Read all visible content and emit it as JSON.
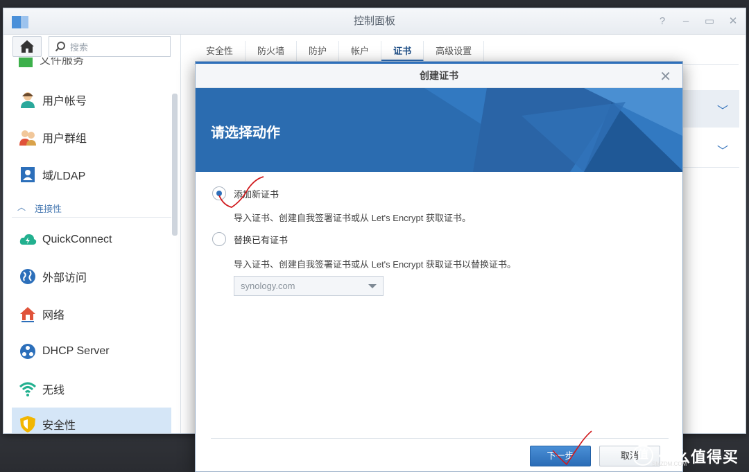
{
  "window": {
    "title": "控制面板",
    "controls": [
      "?",
      "–",
      "▭",
      "✕"
    ]
  },
  "sidebar": {
    "search_placeholder": "搜索",
    "partial_item": "文件服务",
    "section_connectivity": "连接性",
    "items": [
      {
        "label": "用户帐号",
        "icon": "user-icon"
      },
      {
        "label": "用户群组",
        "icon": "group-icon"
      },
      {
        "label": "域/LDAP",
        "icon": "ldap-icon"
      },
      {
        "label": "QuickConnect",
        "icon": "quickconnect-icon"
      },
      {
        "label": "外部访问",
        "icon": "globe-icon"
      },
      {
        "label": "网络",
        "icon": "network-home-icon"
      },
      {
        "label": "DHCP Server",
        "icon": "dhcp-icon"
      },
      {
        "label": "无线",
        "icon": "wifi-icon"
      },
      {
        "label": "安全性",
        "icon": "shield-icon",
        "active": true
      }
    ]
  },
  "tabs": [
    {
      "label": "安全性"
    },
    {
      "label": "防火墙"
    },
    {
      "label": "防护"
    },
    {
      "label": "帐户"
    },
    {
      "label": "证书",
      "active": true
    },
    {
      "label": "高级设置"
    }
  ],
  "dialog": {
    "title": "创建证书",
    "banner": "请选择动作",
    "option1": {
      "label": "添加新证书",
      "description": "导入证书、创建自我签署证书或从 Let's Encrypt 获取证书。",
      "checked": true
    },
    "option2": {
      "label": "替换已有证书",
      "description": "导入证书、创建自我签署证书或从 Let's Encrypt 获取证书以替换证书。",
      "checked": false
    },
    "select_value": "synology.com",
    "next_button": "下一步",
    "cancel_button": "取消"
  },
  "watermark": {
    "logo": "值",
    "text": "什么值得买",
    "url": "SMZDM.COM"
  },
  "colors": {
    "accent": "#2e6fba",
    "banner": "#2b6cb0",
    "annotation": "#d0191c"
  }
}
